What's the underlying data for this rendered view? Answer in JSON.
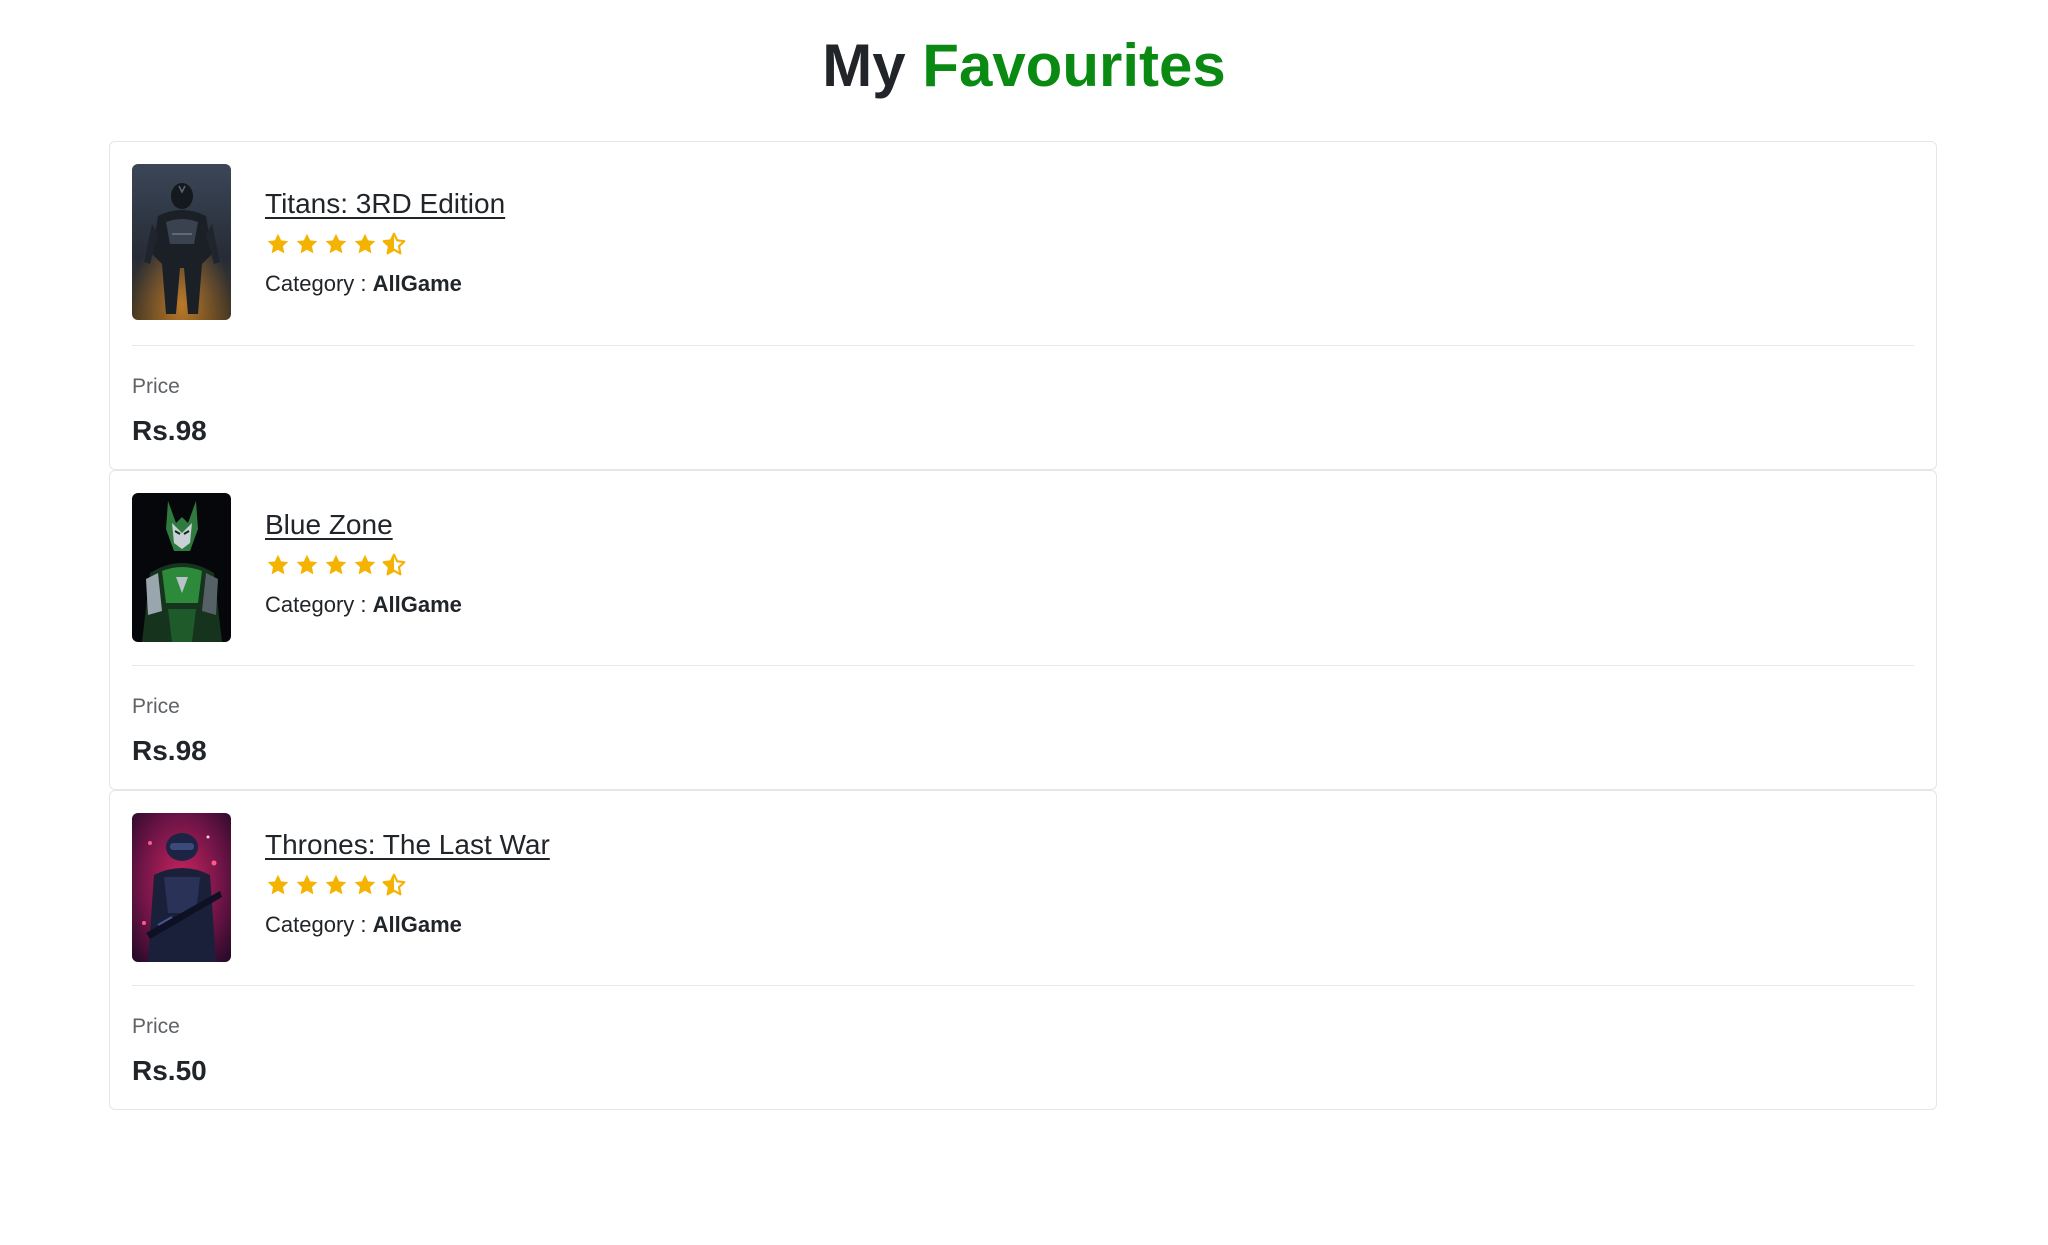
{
  "page": {
    "title_part1": "My",
    "title_part2": "Favourites",
    "accent_color": "#0a8a12"
  },
  "favourites": [
    {
      "title": "Titans: 3RD Edition",
      "rating": 4.5,
      "rating_max": 5,
      "category_label": "Category :",
      "category": "AllGame",
      "price_label": "Price",
      "price": "Rs.98",
      "thumbnail_icon": "dark-armored-hero-image"
    },
    {
      "title": "Blue Zone",
      "rating": 4.5,
      "rating_max": 5,
      "category_label": "Category :",
      "category": "AllGame",
      "price_label": "Price",
      "price": "Rs.98",
      "thumbnail_icon": "green-armored-robot-image"
    },
    {
      "title": "Thrones: The Last War",
      "rating": 4.5,
      "rating_max": 5,
      "category_label": "Category :",
      "category": "AllGame",
      "price_label": "Price",
      "price": "Rs.50",
      "thumbnail_icon": "neon-soldier-image"
    }
  ],
  "colors": {
    "star": "#f5b301",
    "text": "#212529",
    "muted": "#5f6368",
    "border": "#e3e6ea"
  }
}
